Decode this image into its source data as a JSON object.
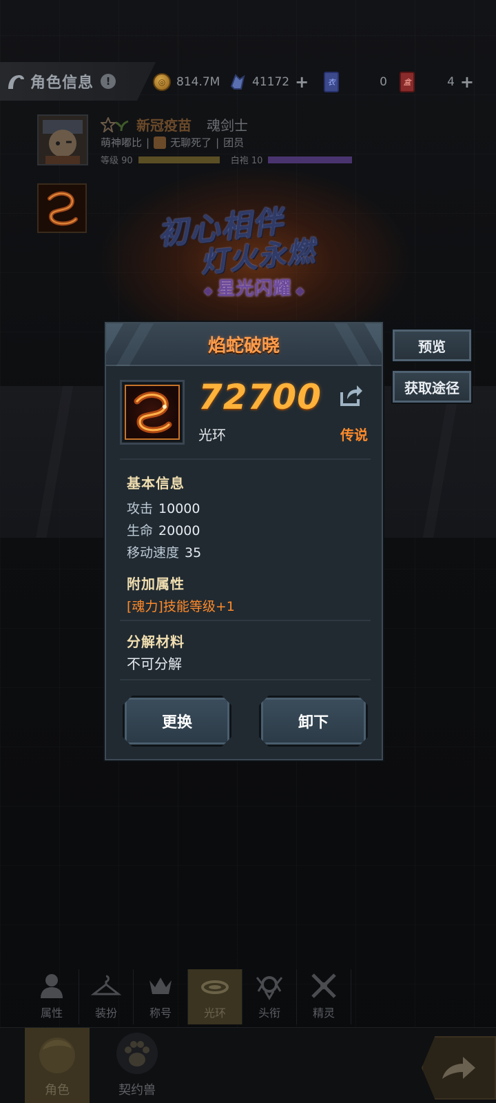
{
  "header": {
    "title": "角色信息",
    "gold": "814.7M",
    "diamonds": "41172",
    "card_blue_count": "0",
    "card_blue_glyph": "衣",
    "card_red_count": "4",
    "card_red_glyph": "盒"
  },
  "player": {
    "name": "新冠疫苗",
    "class": "魂剑士",
    "nickname": "萌神嘟比",
    "guild": "无聊死了",
    "role": "团员",
    "level_label": "等级 90",
    "robe_label": "白袍 10"
  },
  "banner": {
    "line1": "初心相伴",
    "line2": "灯火永燃",
    "line3": "星光闪耀"
  },
  "dialog": {
    "title": "焰蛇破晓",
    "power": "72700",
    "type": "光环",
    "rarity": "传说",
    "basic_title": "基本信息",
    "stats": [
      {
        "key": "攻击",
        "value": "10000"
      },
      {
        "key": "生命",
        "value": "20000"
      },
      {
        "key": "移动速度",
        "value": "35"
      }
    ],
    "extra_title": "附加属性",
    "extra_value": "[魂力]技能等级+1",
    "decompose_title": "分解材料",
    "decompose_value": "不可分解",
    "btn_replace": "更换",
    "btn_unequip": "卸下"
  },
  "side_buttons": {
    "preview": "预览",
    "source": "获取途径"
  },
  "subtabs": [
    {
      "label": "属性",
      "icon": "person-icon"
    },
    {
      "label": "装扮",
      "icon": "hanger-icon"
    },
    {
      "label": "称号",
      "icon": "crown-icon"
    },
    {
      "label": "光环",
      "icon": "halo-icon"
    },
    {
      "label": "头衔",
      "icon": "emblem-icon"
    },
    {
      "label": "精灵",
      "icon": "sprite-icon"
    }
  ],
  "nav": {
    "character": "角色",
    "pet": "契约兽"
  },
  "colors": {
    "accent_orange": "#ff8a2a",
    "power_gold": "#ffb23a",
    "dialog_bg": "#212a31"
  }
}
